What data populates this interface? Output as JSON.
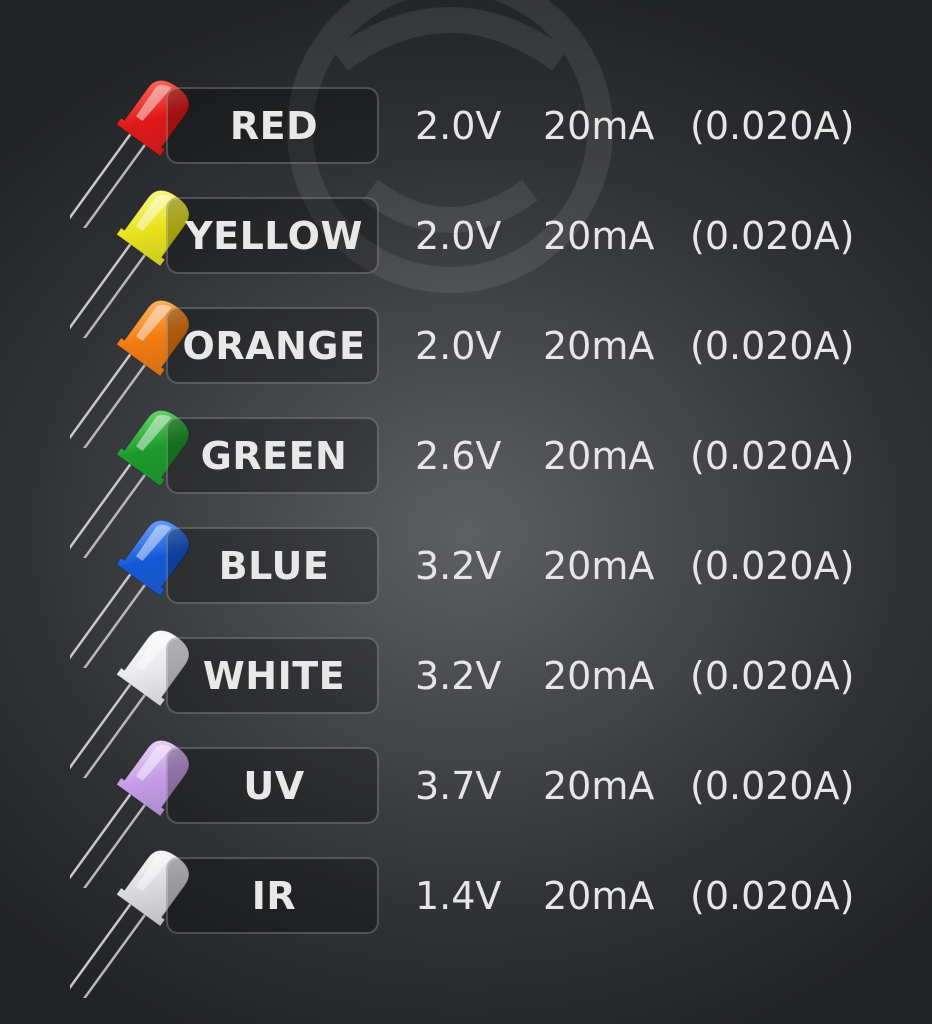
{
  "rows": [
    {
      "name": "RED",
      "voltage": "2.0V",
      "current": "20mA",
      "amps": "(0.020A)",
      "color": "#e01818",
      "hi": "#ff7a6a"
    },
    {
      "name": "YELLOW",
      "voltage": "2.0V",
      "current": "20mA",
      "amps": "(0.020A)",
      "color": "#e8e21c",
      "hi": "#fffca0"
    },
    {
      "name": "ORANGE",
      "voltage": "2.0V",
      "current": "20mA",
      "amps": "(0.020A)",
      "color": "#f07a10",
      "hi": "#ffc27a"
    },
    {
      "name": "GREEN",
      "voltage": "2.6V",
      "current": "20mA",
      "amps": "(0.020A)",
      "color": "#1c9a2a",
      "hi": "#7be07f"
    },
    {
      "name": "BLUE",
      "voltage": "3.2V",
      "current": "20mA",
      "amps": "(0.020A)",
      "color": "#1458d8",
      "hi": "#7fb0ff"
    },
    {
      "name": "WHITE",
      "voltage": "3.2V",
      "current": "20mA",
      "amps": "(0.020A)",
      "color": "#e9e9ee",
      "hi": "#ffffff"
    },
    {
      "name": "UV",
      "voltage": "3.7V",
      "current": "20mA",
      "amps": "(0.020A)",
      "color": "#c59be6",
      "hi": "#f1dfff"
    },
    {
      "name": "IR",
      "voltage": "1.4V",
      "current": "20mA",
      "amps": "(0.020A)",
      "color": "#d7d7dc",
      "hi": "#ffffff"
    }
  ]
}
